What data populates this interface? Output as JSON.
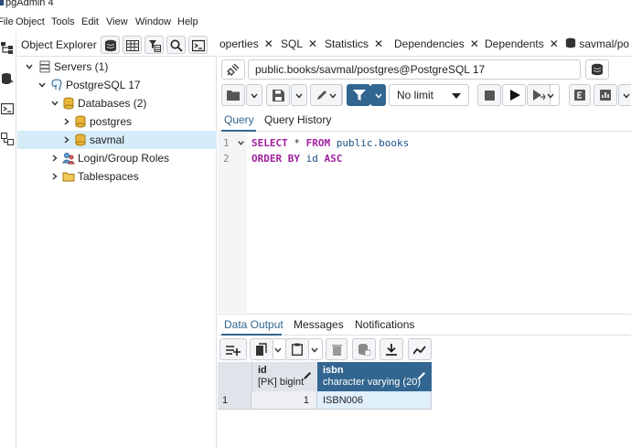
{
  "app": {
    "title": "pgAdmin 4"
  },
  "menu": [
    "File",
    "Object",
    "Tools",
    "Edit",
    "View",
    "Window",
    "Help"
  ],
  "explorer": {
    "title": "Object Explorer",
    "tree": [
      {
        "label": "Servers (1)",
        "icon": "servers-icon"
      },
      {
        "label": "PostgreSQL 17",
        "icon": "elephant-icon"
      },
      {
        "label": "Databases (2)",
        "icon": "databases-icon"
      },
      {
        "label": "postgres",
        "icon": "database-icon"
      },
      {
        "label": "savmal",
        "icon": "database-icon"
      },
      {
        "label": "Login/Group Roles",
        "icon": "roles-icon"
      },
      {
        "label": "Tablespaces",
        "icon": "tablespaces-icon"
      }
    ]
  },
  "tabs": [
    "operties",
    "SQL",
    "Statistics",
    "Dependencies",
    "Dependents",
    "savmal/po"
  ],
  "connection": {
    "value": "public.books/savmal/postgres@PostgreSQL 17"
  },
  "toolbar": {
    "limit": "No limit"
  },
  "query_tabs": [
    "Query",
    "Query History"
  ],
  "editor": {
    "line_numbers": [
      "1",
      "2"
    ],
    "line1": {
      "kw1": "SELECT",
      "op": " * ",
      "kw2": "FROM",
      "ident": " public.books"
    },
    "line2": {
      "kw": "ORDER BY",
      "ident": " id",
      "kw2": " ASC"
    }
  },
  "output_tabs": [
    "Data Output",
    "Messages",
    "Notifications"
  ],
  "grid": {
    "columns": [
      {
        "name": "id",
        "type": "[PK] bigint"
      },
      {
        "name": "isbn",
        "type": "character varying (20)"
      }
    ],
    "rows": [
      {
        "rownum": "1",
        "id": "1",
        "isbn": "ISBN006"
      }
    ]
  },
  "colors": {
    "accent": "#326690",
    "selection": "#d6ecf8",
    "keyword": "#a020a0"
  }
}
